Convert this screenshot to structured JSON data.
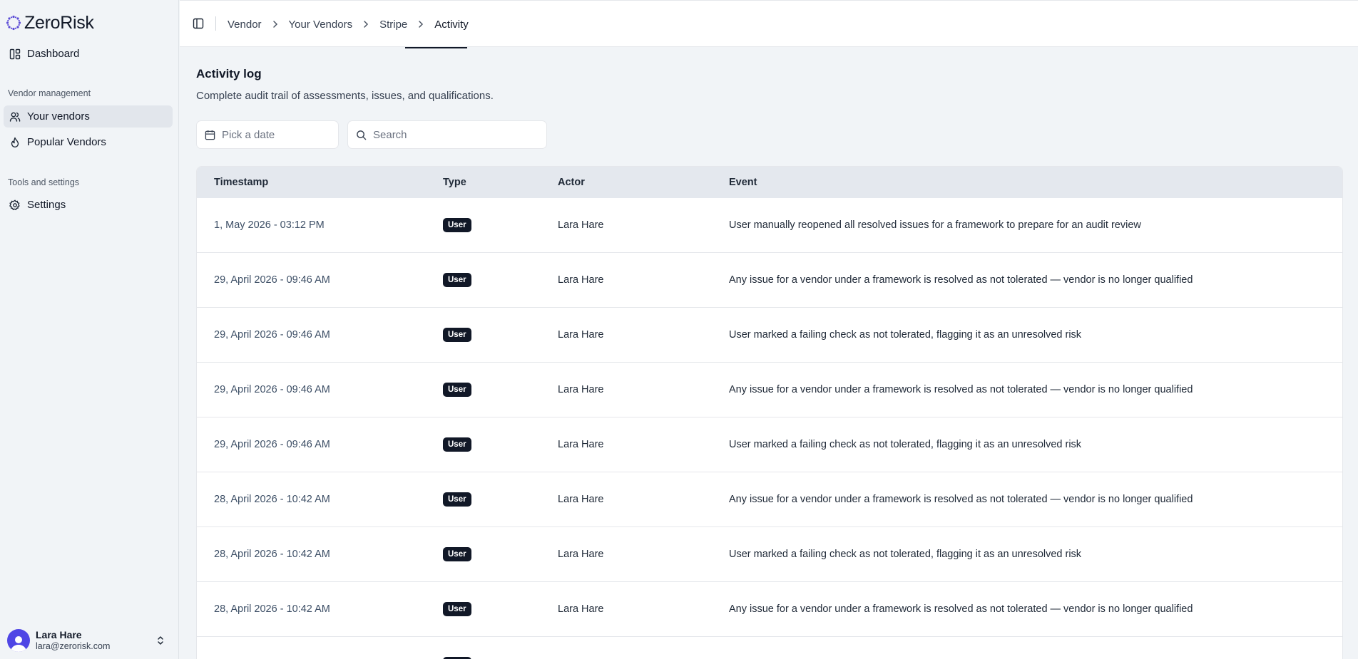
{
  "app": {
    "name": "ZeroRisk"
  },
  "sidebar": {
    "dashboard_label": "Dashboard",
    "sections": [
      {
        "title": "Vendor management"
      },
      {
        "title": "Tools and settings"
      }
    ],
    "items": [
      {
        "label": "Your vendors",
        "icon": "users-icon",
        "active": true
      },
      {
        "label": "Popular Vendors",
        "icon": "flame-icon",
        "active": false
      },
      {
        "label": "Settings",
        "icon": "gear-icon",
        "active": false
      }
    ],
    "user": {
      "name": "Lara Hare",
      "email": "lara@zerorisk.com"
    }
  },
  "breadcrumb": [
    "Vendor",
    "Your Vendors",
    "Stripe",
    "Activity"
  ],
  "main": {
    "title": "Activity log",
    "description": "Complete audit trail of assessments, issues, and qualifications.",
    "date_placeholder": "Pick a date",
    "search_placeholder": "Search"
  },
  "table": {
    "headers": [
      "Timestamp",
      "Type",
      "Actor",
      "Event"
    ],
    "rows": [
      {
        "timestamp": "1, May 2026 - 03:12 PM",
        "type": "User",
        "actor": "Lara Hare",
        "event": "User manually reopened all resolved issues for a framework to prepare for an audit review"
      },
      {
        "timestamp": "29, April 2026 - 09:46 AM",
        "type": "User",
        "actor": "Lara Hare",
        "event": "Any issue for a vendor under a framework is resolved as not tolerated — vendor is no longer qualified"
      },
      {
        "timestamp": "29, April 2026 - 09:46 AM",
        "type": "User",
        "actor": "Lara Hare",
        "event": "User marked a failing check as not tolerated, flagging it as an unresolved risk"
      },
      {
        "timestamp": "29, April 2026 - 09:46 AM",
        "type": "User",
        "actor": "Lara Hare",
        "event": "Any issue for a vendor under a framework is resolved as not tolerated — vendor is no longer qualified"
      },
      {
        "timestamp": "29, April 2026 - 09:46 AM",
        "type": "User",
        "actor": "Lara Hare",
        "event": "User marked a failing check as not tolerated, flagging it as an unresolved risk"
      },
      {
        "timestamp": "28, April 2026 - 10:42 AM",
        "type": "User",
        "actor": "Lara Hare",
        "event": "Any issue for a vendor under a framework is resolved as not tolerated — vendor is no longer qualified"
      },
      {
        "timestamp": "28, April 2026 - 10:42 AM",
        "type": "User",
        "actor": "Lara Hare",
        "event": "User marked a failing check as not tolerated, flagging it as an unresolved risk"
      },
      {
        "timestamp": "28, April 2026 - 10:42 AM",
        "type": "User",
        "actor": "Lara Hare",
        "event": "Any issue for a vendor under a framework is resolved as not tolerated — vendor is no longer qualified"
      },
      {
        "timestamp": "",
        "type": "User",
        "actor": "",
        "event": ""
      }
    ]
  }
}
